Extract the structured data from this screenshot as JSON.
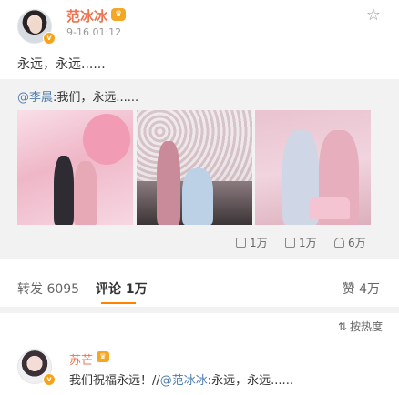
{
  "post": {
    "username": "范冰冰",
    "time": "9-16 01:12",
    "text": "永远，永远......",
    "verified_badge": "v",
    "crown_icon": "crown-icon"
  },
  "repost": {
    "mention": "@李晨",
    "text": ":我们，永远......",
    "images": [
      "photo-1",
      "photo-2",
      "photo-3"
    ],
    "actions": {
      "repost_count": "1万",
      "comment_count": "1万",
      "like_count": "6万"
    }
  },
  "tabs": {
    "repost_label": "转发",
    "repost_count": "6095",
    "comment_label": "评论",
    "comment_count": "1万",
    "like_label": "赞",
    "like_count": "4万"
  },
  "sort": {
    "label": "按热度"
  },
  "comment": {
    "username": "苏芒",
    "text_prefix": "我们祝福永远！//",
    "mention": "@范冰冰",
    "text_suffix": ":永远，永远......"
  },
  "colors": {
    "username": "#eb7350",
    "link": "#507daf",
    "accent": "#ff8200",
    "repost_bg": "#f2f2f2"
  }
}
